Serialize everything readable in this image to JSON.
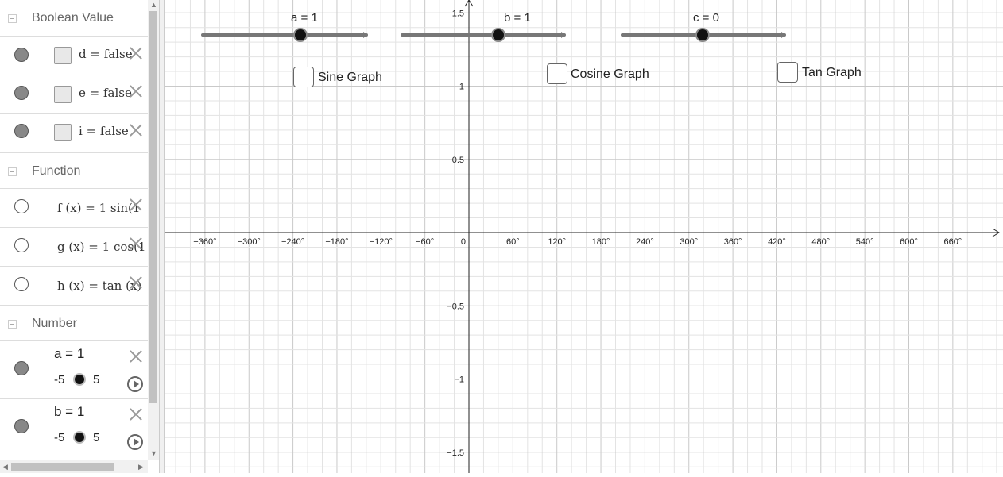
{
  "groups": {
    "boolean": "Boolean Value",
    "function": "Function",
    "number": "Number"
  },
  "booleans": [
    {
      "expr": "d = false"
    },
    {
      "expr": "e = false"
    },
    {
      "expr": "i = false"
    }
  ],
  "functions": [
    {
      "expr": "f (x) = 1 sin(1"
    },
    {
      "expr": "g (x) = 1 cos(1"
    },
    {
      "expr": "h (x) = tan (x)"
    }
  ],
  "numbers": [
    {
      "label": "a = 1",
      "min": "-5",
      "max": "5"
    },
    {
      "label": "b = 1",
      "min": "-5",
      "max": "5"
    }
  ],
  "graph": {
    "sliders": [
      {
        "label": "a = 1"
      },
      {
        "label": "b = 1"
      },
      {
        "label": "c = 0"
      }
    ],
    "checkboxes": [
      {
        "label": "Sine Graph"
      },
      {
        "label": "Cosine Graph"
      },
      {
        "label": "Tan Graph"
      }
    ],
    "x_ticks": [
      "−360°",
      "−300°",
      "−240°",
      "−180°",
      "−120°",
      "−60°",
      "0",
      "60°",
      "120°",
      "180°",
      "240°",
      "300°",
      "360°",
      "420°",
      "480°",
      "540°",
      "600°",
      "660°"
    ],
    "y_ticks": [
      "1.5",
      "1",
      "0.5",
      "−0.5",
      "−1",
      "−1.5"
    ]
  },
  "colors": {
    "grid_minor": "#e3e3e3",
    "grid_major": "#c9c9c9",
    "axis": "#222222"
  }
}
